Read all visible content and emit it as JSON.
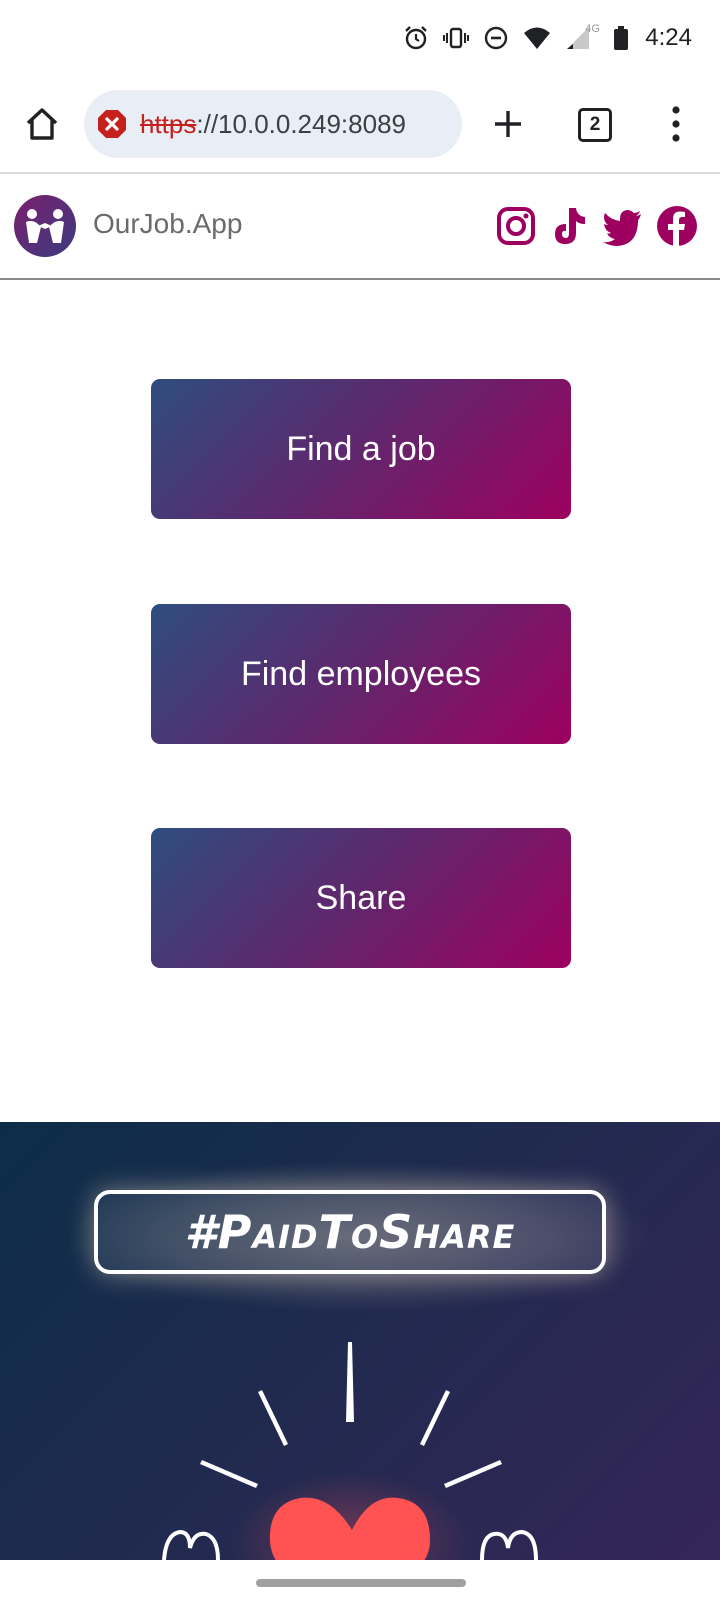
{
  "status_bar": {
    "time": "4:24",
    "network": "4G",
    "icons": [
      "alarm-icon",
      "vibrate-icon",
      "do-not-disturb-icon",
      "wifi-icon",
      "signal-icon",
      "battery-icon"
    ]
  },
  "browser": {
    "url_scheme": "https",
    "url_rest": "://10.0.0.249:8089",
    "tab_count": "2",
    "icons": [
      "home-icon",
      "not-secure-icon",
      "plus-icon",
      "tabs-icon",
      "more-vert-icon"
    ]
  },
  "site": {
    "name": "OurJob.App",
    "logo_icon": "ourjob-logo-icon",
    "social": [
      "instagram-icon",
      "tiktok-icon",
      "twitter-icon",
      "facebook-icon"
    ],
    "brand_color": "#9e005f"
  },
  "actions": {
    "find_job": "Find a job",
    "find_employees": "Find employees",
    "share": "Share"
  },
  "promo": {
    "hashtag": "#PaidToShare",
    "art": "heart-icon",
    "heart_color": "#ff5252"
  }
}
